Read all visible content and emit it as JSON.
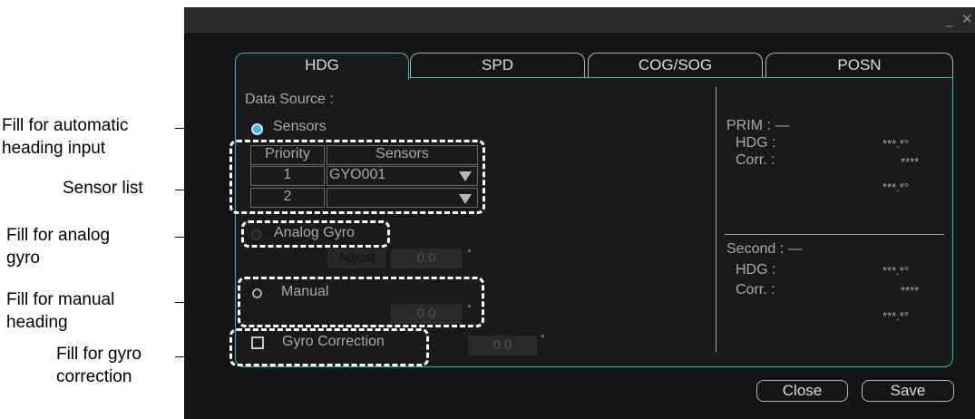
{
  "callouts": {
    "auto_line1": "Fill for automatic",
    "auto_line2": "heading input",
    "sensor_list": "Sensor list",
    "analog_line1": "Fill for analog",
    "analog_line2": "gyro",
    "manual_line1": "Fill for manual",
    "manual_line2": "heading",
    "gyrocorr_line1": "Fill for gyro",
    "gyrocorr_line2": "correction"
  },
  "window": {
    "minimize": "_",
    "close": "✕"
  },
  "tabs": [
    {
      "label": "HDG"
    },
    {
      "label": "SPD"
    },
    {
      "label": "COG/SOG"
    },
    {
      "label": "POSN"
    }
  ],
  "data_source": {
    "label": "Data Source :",
    "sensors_label": "Sensors",
    "table": {
      "headers": [
        "Priority",
        "Sensors"
      ],
      "rows": [
        {
          "priority": "1",
          "sensor": "GYO001"
        },
        {
          "priority": "2",
          "sensor": ""
        }
      ]
    },
    "analog_gyro_label": "Analog Gyro",
    "adjust_label": "Adjust",
    "adjust_value": "0.0",
    "manual_label": "Manual",
    "manual_value": "0.0",
    "gyro_correction_label": "Gyro Correction",
    "gyro_correction_value": "0.0",
    "degree": "°"
  },
  "status": {
    "prim_label": "PRIM : —",
    "prim_hdg_label": "HDG :",
    "prim_hdg_value": "***.*°",
    "prim_corr_label": "Corr. :",
    "prim_corr_value": "****",
    "prim_extra_value": "***.*°",
    "second_label": "Second : —",
    "second_hdg_label": "HDG :",
    "second_hdg_value": "***.*°",
    "second_corr_label": "Corr. :",
    "second_corr_value": "****",
    "second_extra_value": "***.*°"
  },
  "buttons": {
    "close": "Close",
    "save": "Save"
  },
  "colors": {
    "accent": "#2bbdbd",
    "radio_selected": "#39b9e6",
    "background": "#141414"
  }
}
